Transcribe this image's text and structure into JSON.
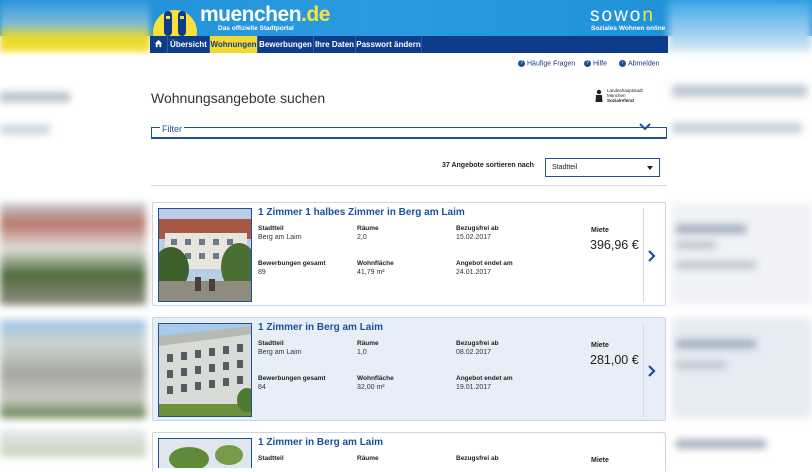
{
  "header": {
    "logo_name": "muenchen",
    "logo_tld": ".de",
    "logo_tagline": "Das offizielle Stadtportal",
    "brand_name_a": "sowo",
    "brand_name_b": "n",
    "brand_tagline": "Soziales Wohnen online"
  },
  "nav": {
    "home_icon": "home-icon",
    "items": [
      {
        "label": "Übersicht"
      },
      {
        "label": "Wohnungen",
        "active": true
      },
      {
        "label": "Bewerbungen"
      },
      {
        "label": "Ihre Daten"
      },
      {
        "label": "Passwort ändern"
      }
    ]
  },
  "toplinks": {
    "faq": "Häufige Fragen",
    "help": "Hilfe",
    "logout": "Abmelden"
  },
  "page": {
    "title": "Wohnungsangebote suchen",
    "org_line1": "Landeshauptstadt",
    "org_line2": "München",
    "org_line3": "Sozialreferat",
    "filter_label": "Filter",
    "sort_label": "37 Angebote sortieren nach",
    "sort_value": "Stadtteil"
  },
  "labels": {
    "district": "Stadtteil",
    "rooms": "Räume",
    "available": "Bezugsfrei ab",
    "rent": "Miete",
    "applications": "Bewerbungen gesamt",
    "area": "Wohnfläche",
    "offer_end": "Angebot endet am"
  },
  "listings": [
    {
      "title": "1 Zimmer 1 halbes Zimmer in Berg am Laim",
      "district": "Berg am Laim",
      "rooms": "2,0",
      "available": "15.02.2017",
      "applications": "89",
      "area": "41,79 m²",
      "offer_end": "24.01.2017",
      "rent": "396,96 €"
    },
    {
      "title": "1 Zimmer in Berg am Laim",
      "district": "Berg am Laim",
      "rooms": "1,0",
      "available": "08.02.2017",
      "applications": "84",
      "area": "32,00 m²",
      "offer_end": "19.01.2017",
      "rent": "281,00 €"
    },
    {
      "title": "1 Zimmer in Berg am Laim",
      "district": "",
      "rooms": "",
      "available": "",
      "applications": "",
      "area": "",
      "offer_end": "",
      "rent": ""
    }
  ],
  "colors": {
    "header_blue": "#1d8fd6",
    "nav_blue": "#0e3c8b",
    "active_yellow": "#f5d930",
    "link_blue": "#1c4f9c"
  }
}
